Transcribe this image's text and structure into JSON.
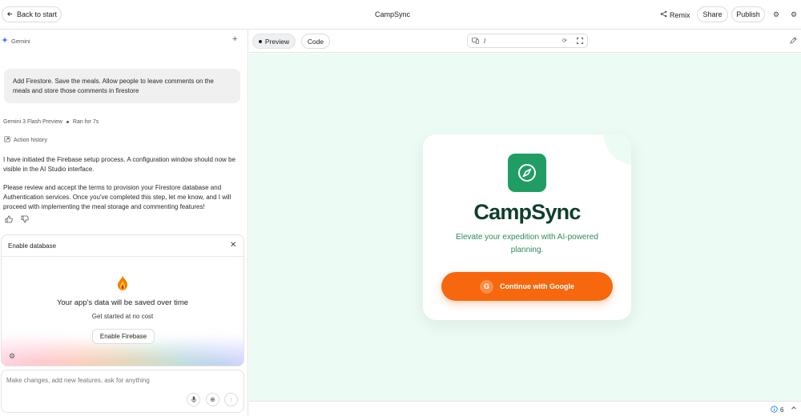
{
  "header": {
    "back_label": "Back to start",
    "app_title": "CampSync",
    "remix_label": "Remix",
    "share_label": "Share",
    "publish_label": "Publish"
  },
  "sidebar": {
    "model_name": "Gemini",
    "user_message": "Add Firestore. Save the meals. Allow people to leave comments on the meals and store those comments in firestore",
    "model_version": "Gemini 3 Flash Preview",
    "run_time": "Ran for 7s",
    "action_history_label": "Action history",
    "response_paragraphs": [
      "I have initiated the Firebase setup process. A configuration window should now be visible in the AI Studio interface.",
      "Please review and accept the terms to provision your Firestore database and Authentication services. Once you've completed this step, let me know, and I will proceed with implementing the meal storage and commenting features!"
    ],
    "enable_card": {
      "title": "Enable database",
      "heading": "Your app's data will be saved over time",
      "subtext": "Get started at no cost",
      "button_label": "Enable Firebase"
    },
    "prompt": {
      "placeholder": "Make changes, add new features, ask for anything"
    }
  },
  "toolbar": {
    "preview_tab": "Preview",
    "code_tab": "Code",
    "url_path": "/"
  },
  "preview": {
    "brand_name": "CampSync",
    "tagline": "Elevate your expedition with AI-powered planning.",
    "google_button_label": "Continue with Google",
    "google_glyph": "G"
  },
  "statusbar": {
    "issue_count": "6"
  },
  "colors": {
    "accent_green": "#1f9d64",
    "brand_dark": "#0f3f2c",
    "cta_orange": "#f7670d",
    "preview_bg": "#ecfbf3"
  }
}
